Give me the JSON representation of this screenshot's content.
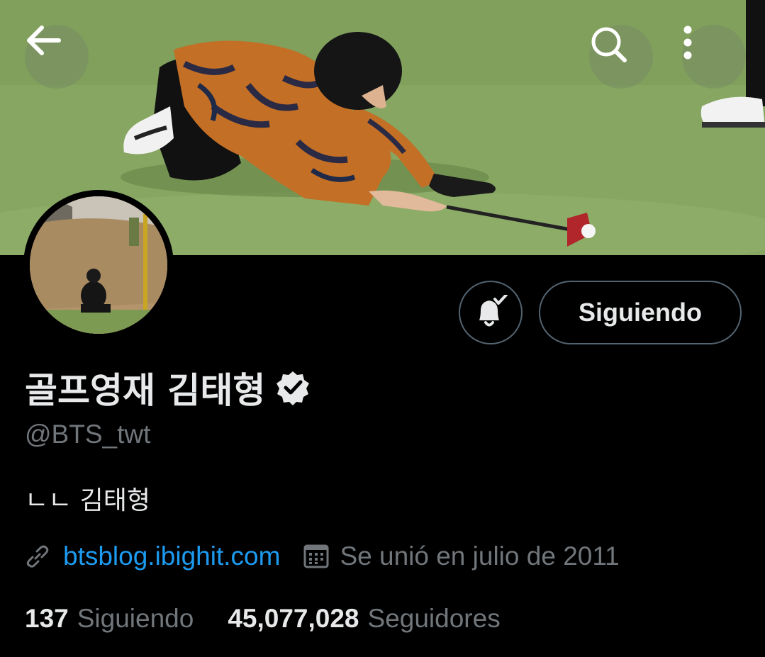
{
  "header": {
    "back_icon": "arrow-left-icon",
    "search_icon": "search-icon",
    "more_icon": "more-vertical-icon"
  },
  "banner": {
    "description_colors": {
      "grass": "#87a862",
      "shirt": "#c9762a",
      "club_head": "#b0262a"
    }
  },
  "profile": {
    "display_name": "골프영재 김태형",
    "verified_icon": "verified-badge-icon",
    "handle": "@BTS_twt",
    "bio": "ㄴㄴ 김태형",
    "website": "btsblog.ibighit.com",
    "joined": "Se unió en julio de 2011",
    "following_count": "137",
    "following_label": "Siguiendo",
    "followers_count": "45,077,028",
    "followers_label": "Seguidores"
  },
  "actions": {
    "notify_icon": "bell-check-icon",
    "follow_label": "Siguiendo"
  },
  "colors": {
    "background": "#000000",
    "text_primary": "#e7e9ea",
    "text_secondary": "#71767b",
    "link": "#1d9bf0",
    "border": "#536471"
  }
}
